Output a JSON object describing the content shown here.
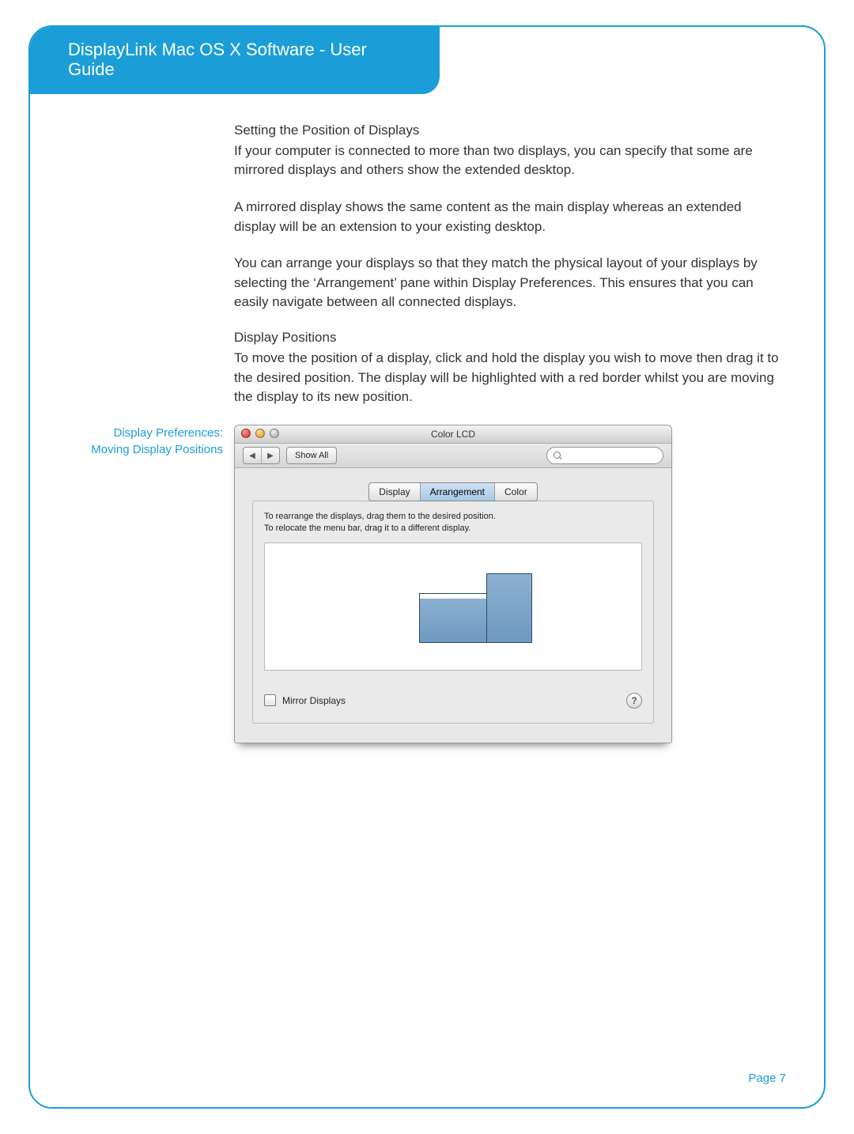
{
  "header": {
    "title": "DisplayLink Mac OS X Software - User Guide"
  },
  "sidebar": {
    "caption_line1": "Display Preferences:",
    "caption_line2": "Moving Display Positions"
  },
  "body": {
    "h1": "Setting the Position of Displays",
    "p1": "If your computer is connected to more than two displays, you can specify that some are mirrored displays and others show the extended desktop.",
    "p2": "A mirrored display shows the same content as the main display whereas an extended display will be an extension to your existing desktop.",
    "p3": "You can arrange your displays so that they match the physical layout of your displays by selecting the ‘Arrangement’ pane within Display Preferences. This ensures that you can easily navigate between all connected displays.",
    "h2": "Display Positions",
    "p4": "To move the position of a display, click and hold the display you wish to move then drag it to the desired position. The display will be highlighted with a red border whilst you are moving the display to its new position."
  },
  "window": {
    "title": "Color LCD",
    "nav_back": "◀",
    "nav_fwd": "▶",
    "show_all": "Show All",
    "search_placeholder": "",
    "tabs": {
      "display": "Display",
      "arrangement": "Arrangement",
      "color": "Color"
    },
    "hint_line1": "To rearrange the displays, drag them to the desired position.",
    "hint_line2": "To relocate the menu bar, drag it to a different display.",
    "mirror_label": "Mirror Displays",
    "help_glyph": "?"
  },
  "footer": {
    "page_label": "Page 7"
  }
}
